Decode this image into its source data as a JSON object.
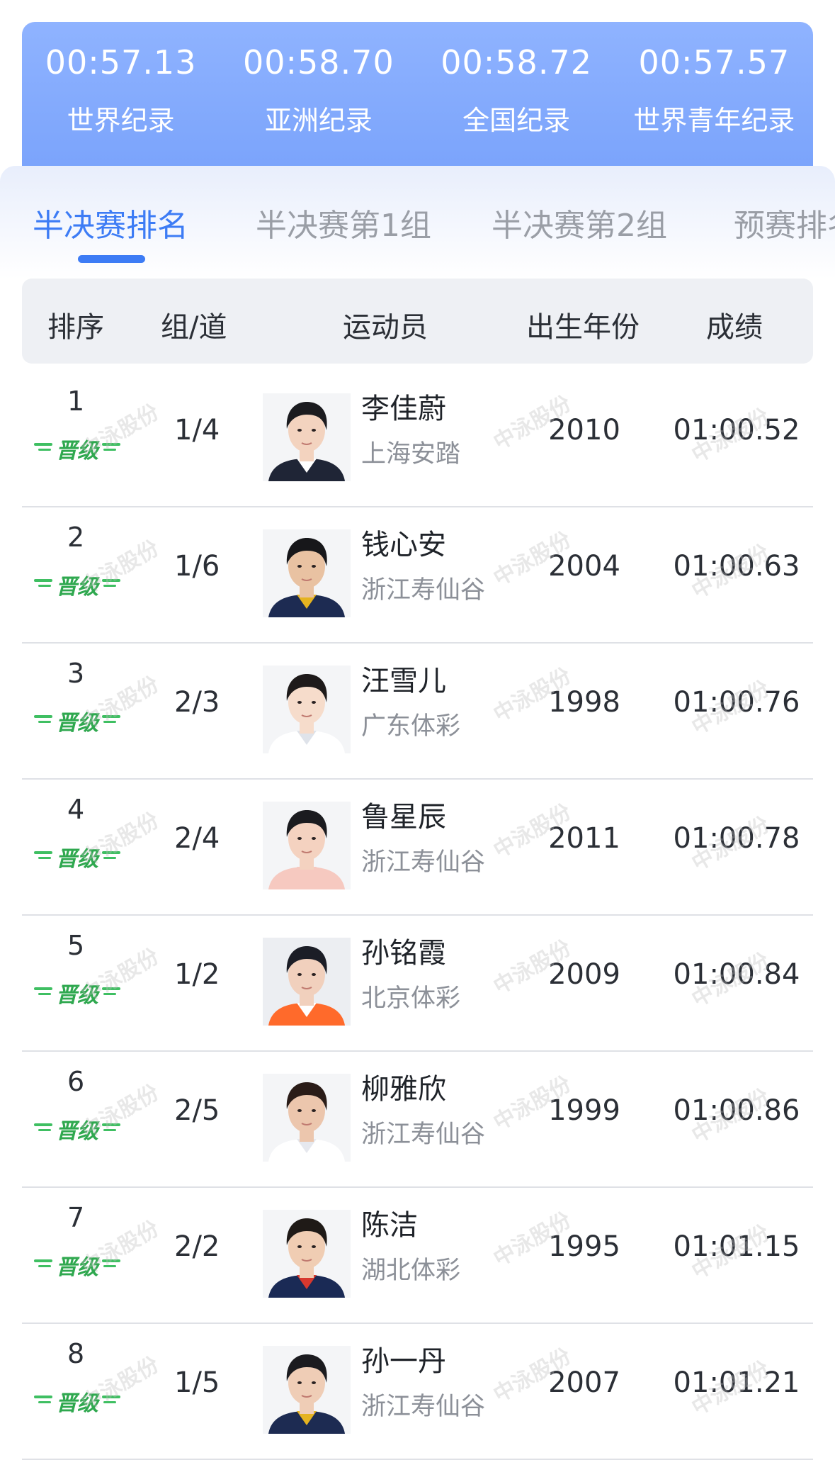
{
  "records": [
    {
      "time": "00:57.13",
      "label": "世界纪录"
    },
    {
      "time": "00:58.70",
      "label": "亚洲纪录"
    },
    {
      "time": "00:58.72",
      "label": "全国纪录"
    },
    {
      "time": "00:57.57",
      "label": "世界青年纪录"
    }
  ],
  "tabs": [
    {
      "label": "半决赛排名",
      "active": true
    },
    {
      "label": "半决赛第1组",
      "active": false
    },
    {
      "label": "半决赛第2组",
      "active": false
    },
    {
      "label": "预赛排名",
      "active": false
    }
  ],
  "table": {
    "headers": {
      "rank": "排序",
      "lane": "组/道",
      "athlete": "运动员",
      "birth_year": "出生年份",
      "result": "成绩"
    },
    "qualified_badge": "晋级",
    "watermark_text": "中泳股份",
    "rows": [
      {
        "rank": "1",
        "lane": "1/4",
        "name": "李佳蔚",
        "team": "上海安踏",
        "birth_year": "2010",
        "result": "01:00.52",
        "photo": {
          "bg": "#f4f5f7",
          "hair": "#1b1b1f",
          "skin": "#f3d3bf",
          "cloth": "#1f2536",
          "accent": "#ffffff"
        }
      },
      {
        "rank": "2",
        "lane": "1/6",
        "name": "钱心安",
        "team": "浙江寿仙谷",
        "birth_year": "2004",
        "result": "01:00.63",
        "photo": {
          "bg": "#f4f5f7",
          "hair": "#17171a",
          "skin": "#e9c2a2",
          "cloth": "#1d2b52",
          "accent": "#e5b320"
        }
      },
      {
        "rank": "3",
        "lane": "2/3",
        "name": "汪雪儿",
        "team": "广东体彩",
        "birth_year": "1998",
        "result": "01:00.76",
        "photo": {
          "bg": "#f4f5f7",
          "hair": "#1e1a1a",
          "skin": "#f6dccb",
          "cloth": "#ffffff",
          "accent": "#dfe3ea"
        }
      },
      {
        "rank": "4",
        "lane": "2/4",
        "name": "鲁星辰",
        "team": "浙江寿仙谷",
        "birth_year": "2011",
        "result": "01:00.78",
        "photo": {
          "bg": "#f4f5f7",
          "hair": "#1b1b1f",
          "skin": "#f4d2c0",
          "cloth": "#f6c9c0",
          "accent": "#f6c9c0"
        }
      },
      {
        "rank": "5",
        "lane": "1/2",
        "name": "孙铭霞",
        "team": "北京体彩",
        "birth_year": "2009",
        "result": "01:00.84",
        "photo": {
          "bg": "#eceef2",
          "hair": "#1b1d26",
          "skin": "#f1d0bd",
          "cloth": "#ff6a2b",
          "accent": "#ffffff"
        }
      },
      {
        "rank": "6",
        "lane": "2/5",
        "name": "柳雅欣",
        "team": "浙江寿仙谷",
        "birth_year": "1999",
        "result": "01:00.86",
        "photo": {
          "bg": "#f4f5f7",
          "hair": "#2a1c18",
          "skin": "#ecc6ad",
          "cloth": "#ffffff",
          "accent": "#e6e8ee"
        }
      },
      {
        "rank": "7",
        "lane": "2/2",
        "name": "陈洁",
        "team": "湖北体彩",
        "birth_year": "1995",
        "result": "01:01.15",
        "photo": {
          "bg": "#f4f5f7",
          "hair": "#1f1a17",
          "skin": "#f0cdb3",
          "cloth": "#1a2a55",
          "accent": "#d8382e"
        }
      },
      {
        "rank": "8",
        "lane": "1/5",
        "name": "孙一丹",
        "team": "浙江寿仙谷",
        "birth_year": "2007",
        "result": "01:01.21",
        "photo": {
          "bg": "#f4f5f7",
          "hair": "#1b1b1f",
          "skin": "#efcdb6",
          "cloth": "#1d2b52",
          "accent": "#e5b320"
        }
      }
    ]
  },
  "colors": {
    "accent": "#3d7cf5",
    "banner": "#7aa3fb",
    "qualified": "#2fa84f"
  }
}
